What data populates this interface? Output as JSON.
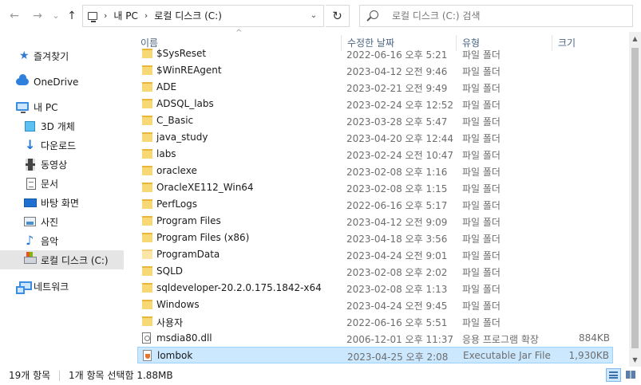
{
  "nav": {
    "back_glyph": "←",
    "forward_glyph": "→",
    "recent_glyph": "⌄",
    "up_glyph": "↑",
    "crumbs": [
      "내 PC",
      "로컬 디스크 (C:)"
    ],
    "crumb_sep": "›",
    "dropdown_glyph": "⌄",
    "refresh_glyph": "↻",
    "search_placeholder": "로컬 디스크 (C:) 검색"
  },
  "sidebar": {
    "items": [
      {
        "label": "즐겨찾기",
        "icon": "star-icon"
      },
      {
        "label": "OneDrive",
        "icon": "cloud-icon"
      },
      {
        "label": "내 PC",
        "icon": "pc-icon"
      },
      {
        "label": "3D 개체",
        "icon": "cube-icon"
      },
      {
        "label": "다운로드",
        "icon": "download-icon"
      },
      {
        "label": "동영상",
        "icon": "video-icon"
      },
      {
        "label": "문서",
        "icon": "document-icon"
      },
      {
        "label": "바탕 화면",
        "icon": "desktop-icon"
      },
      {
        "label": "사진",
        "icon": "picture-icon"
      },
      {
        "label": "음악",
        "icon": "music-icon"
      },
      {
        "label": "로컬 디스크 (C:)",
        "icon": "drive-icon"
      },
      {
        "label": "네트워크",
        "icon": "network-icon"
      }
    ]
  },
  "columns": {
    "name": "이름",
    "date": "수정한 날짜",
    "type": "유형",
    "size": "크기"
  },
  "files": [
    {
      "name": "$SysReset",
      "date": "2022-06-16 오후 5:21",
      "type": "파일 폴더",
      "size": "",
      "kind": "folder"
    },
    {
      "name": "$WinREAgent",
      "date": "2023-04-12 오전 9:46",
      "type": "파일 폴더",
      "size": "",
      "kind": "folder"
    },
    {
      "name": "ADE",
      "date": "2023-02-21 오전 9:49",
      "type": "파일 폴더",
      "size": "",
      "kind": "folder"
    },
    {
      "name": "ADSQL_labs",
      "date": "2023-02-24 오후 12:52",
      "type": "파일 폴더",
      "size": "",
      "kind": "folder"
    },
    {
      "name": "C_Basic",
      "date": "2023-03-28 오후 5:47",
      "type": "파일 폴더",
      "size": "",
      "kind": "folder"
    },
    {
      "name": "java_study",
      "date": "2023-04-20 오후 12:44",
      "type": "파일 폴더",
      "size": "",
      "kind": "folder"
    },
    {
      "name": "labs",
      "date": "2023-02-24 오전 10:47",
      "type": "파일 폴더",
      "size": "",
      "kind": "folder"
    },
    {
      "name": "oraclexe",
      "date": "2023-02-08 오후 1:16",
      "type": "파일 폴더",
      "size": "",
      "kind": "folder"
    },
    {
      "name": "OracleXE112_Win64",
      "date": "2023-02-08 오후 1:15",
      "type": "파일 폴더",
      "size": "",
      "kind": "folder"
    },
    {
      "name": "PerfLogs",
      "date": "2022-06-16 오후 5:17",
      "type": "파일 폴더",
      "size": "",
      "kind": "folder"
    },
    {
      "name": "Program Files",
      "date": "2023-04-12 오전 9:09",
      "type": "파일 폴더",
      "size": "",
      "kind": "folder"
    },
    {
      "name": "Program Files (x86)",
      "date": "2023-04-18 오후 3:56",
      "type": "파일 폴더",
      "size": "",
      "kind": "folder"
    },
    {
      "name": "ProgramData",
      "date": "2023-04-24 오전 9:01",
      "type": "파일 폴더",
      "size": "",
      "kind": "folder-pale"
    },
    {
      "name": "SQLD",
      "date": "2023-02-08 오후 2:02",
      "type": "파일 폴더",
      "size": "",
      "kind": "folder"
    },
    {
      "name": "sqldeveloper-20.2.0.175.1842-x64",
      "date": "2023-02-08 오후 1:13",
      "type": "파일 폴더",
      "size": "",
      "kind": "folder"
    },
    {
      "name": "Windows",
      "date": "2023-04-24 오전 9:45",
      "type": "파일 폴더",
      "size": "",
      "kind": "folder"
    },
    {
      "name": "사용자",
      "date": "2022-06-16 오후 5:51",
      "type": "파일 폴더",
      "size": "",
      "kind": "folder"
    },
    {
      "name": "msdia80.dll",
      "date": "2006-12-01 오후 11:37",
      "type": "응용 프로그램 확장",
      "size": "884KB",
      "kind": "dll"
    },
    {
      "name": "lombok",
      "date": "2023-04-25 오후 2:08",
      "type": "Executable Jar File",
      "size": "1,930KB",
      "kind": "jar",
      "selected": true
    }
  ],
  "status": {
    "count": "19개 항목",
    "selection": "1개 항목 선택함 1.88MB"
  },
  "colors": {
    "selection_bg": "#cce8ff",
    "selection_border": "#99d1ff",
    "folder": "#f8d775"
  }
}
